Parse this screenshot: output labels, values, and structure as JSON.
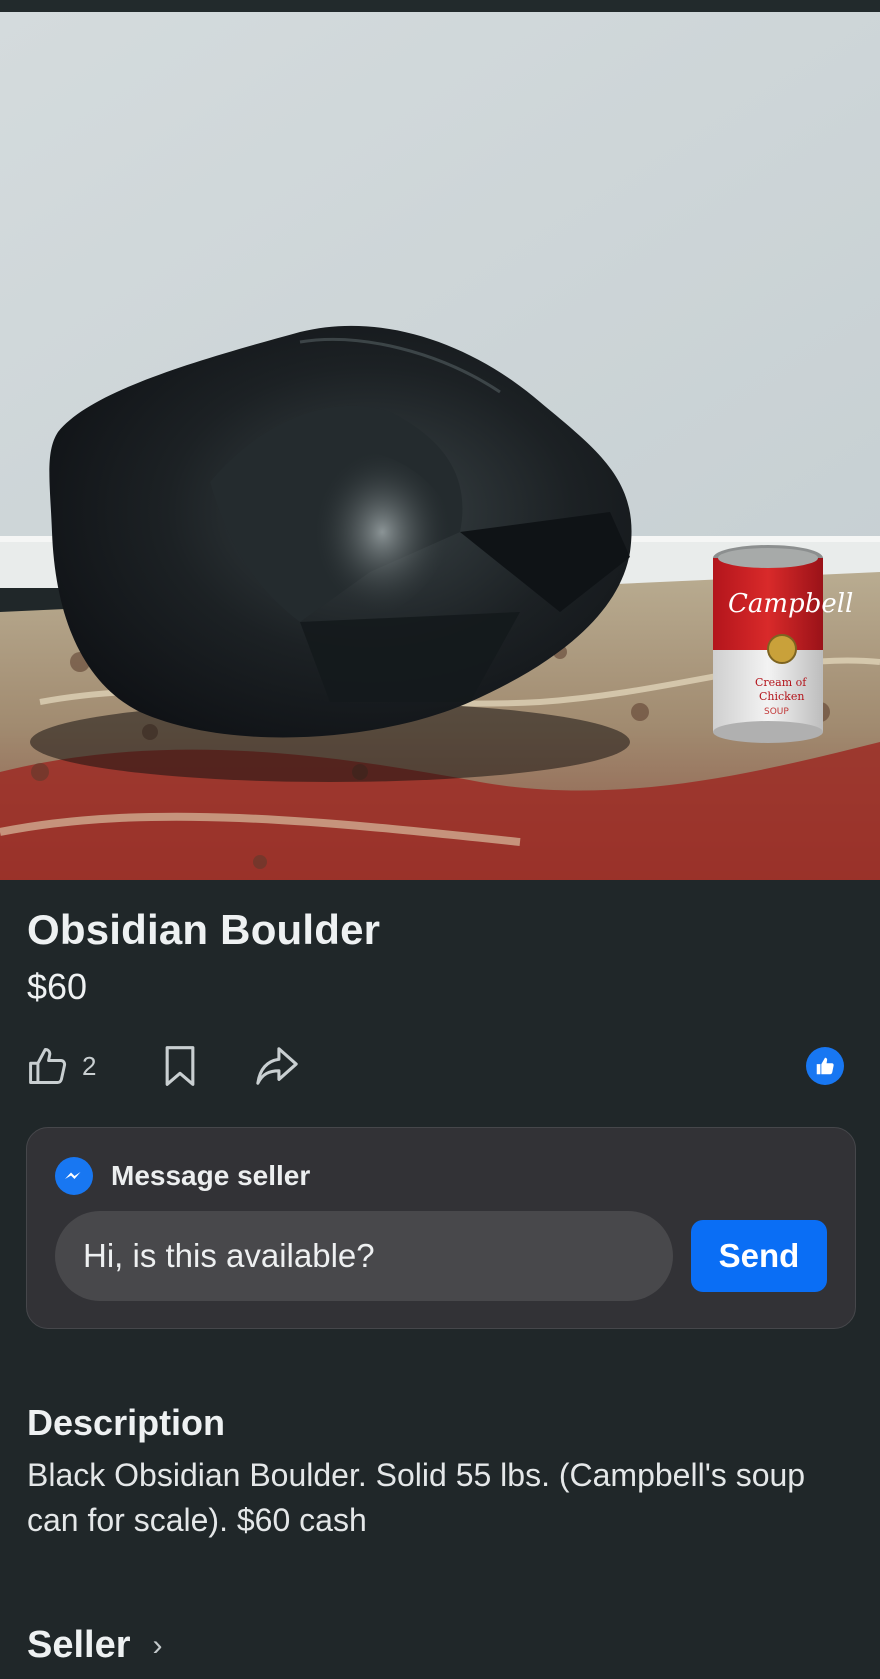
{
  "listing": {
    "title": "Obsidian Boulder",
    "price": "$60",
    "image_alt": "Black obsidian boulder on a rug next to a Campbell's soup can",
    "can_brand": "Campbell",
    "can_line1": "Cream of",
    "can_line2": "Chicken",
    "can_line3": "SOUP"
  },
  "actions": {
    "like_icon": "thumbs-up-outline-icon",
    "like_count": "2",
    "save_icon": "bookmark-icon",
    "share_icon": "share-arrow-icon",
    "reaction_icon": "like-reaction-badge-icon"
  },
  "message": {
    "icon": "messenger-icon",
    "title": "Message seller",
    "input_value": "Hi, is this available?",
    "send_label": "Send"
  },
  "description": {
    "heading": "Description",
    "body": "Black Obsidian Boulder. Solid 55 lbs. (Campbell's soup can for scale). $60 cash"
  },
  "seller": {
    "label": "Seller",
    "chevron": "›"
  },
  "colors": {
    "background": "#202729",
    "accent": "#0a6ef5",
    "card": "#323236"
  }
}
